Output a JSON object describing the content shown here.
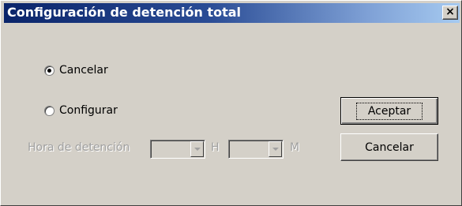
{
  "window": {
    "title": "Configuración de detención total",
    "close_label": "×"
  },
  "options": {
    "cancel_label": "Cancelar",
    "configure_label": "Configurar",
    "selected": "cancel"
  },
  "time": {
    "label": "Hora de detención",
    "hour_unit": "H",
    "minute_unit": "M",
    "hour_value": "",
    "minute_value": ""
  },
  "buttons": {
    "accept_label": "Aceptar",
    "cancel_label": "Cancelar"
  }
}
